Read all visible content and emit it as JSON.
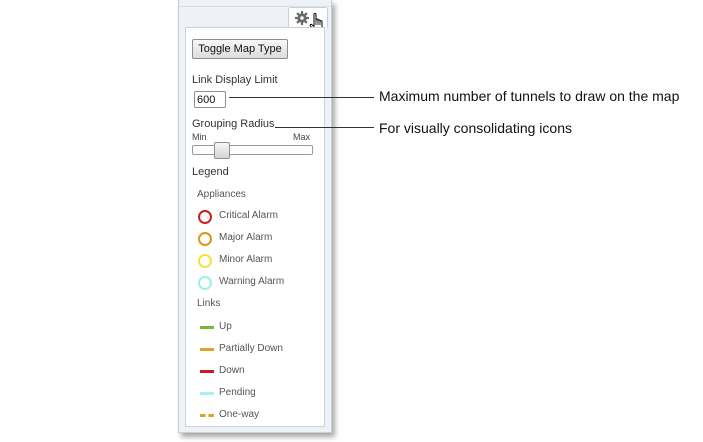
{
  "settings_panel": {
    "toggle_button_label": "Toggle Map Type",
    "link_display_limit": {
      "label": "Link Display Limit",
      "value": "600"
    },
    "grouping_radius": {
      "label": "Grouping Radius",
      "min_label": "Min",
      "max_label": "Max",
      "value_fraction": 0.2
    },
    "legend": {
      "title": "Legend",
      "appliances_heading": "Appliances",
      "appliances": [
        {
          "label": "Critical Alarm",
          "color": "#cc1f1f"
        },
        {
          "label": "Major Alarm",
          "color": "#d99a1a"
        },
        {
          "label": "Minor Alarm",
          "color": "#f0e43c"
        },
        {
          "label": "Warning Alarm",
          "color": "#9eeeee"
        }
      ],
      "links_heading": "Links",
      "links": [
        {
          "label": "Up",
          "color": "#7ab833",
          "style": "solid"
        },
        {
          "label": "Partially Down",
          "color": "#e3a12b",
          "style": "solid"
        },
        {
          "label": "Down",
          "color": "#c41e1e",
          "style": "solid"
        },
        {
          "label": "Pending",
          "color": "#a6f0ef",
          "style": "solid"
        },
        {
          "label": "One-way",
          "color": "#e3a12b",
          "style": "dashed"
        }
      ]
    },
    "gear_icon": "gear-icon",
    "cursor_icon": "hand-pointer-icon"
  },
  "callouts": {
    "link_limit": "Maximum number of tunnels to draw on the map",
    "grouping_radius": "For visually consolidating icons"
  }
}
